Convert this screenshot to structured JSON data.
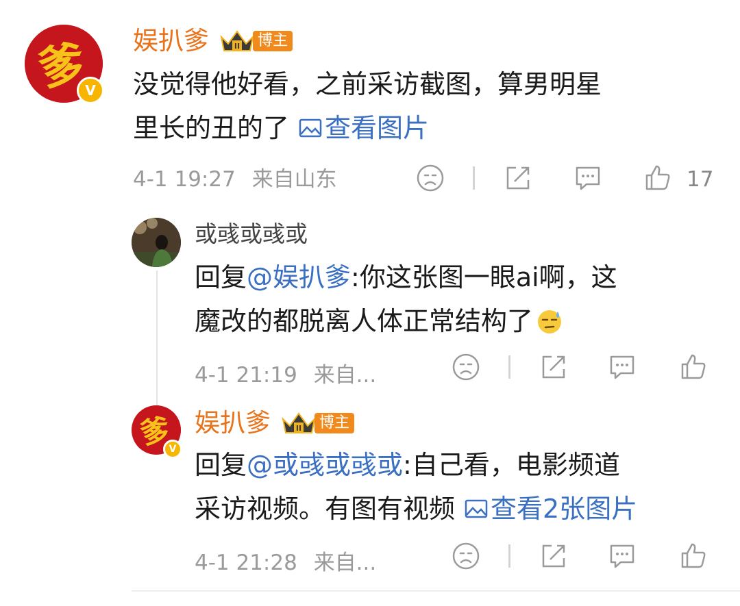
{
  "comment": {
    "username": "娱扒爹",
    "badge_label": "博主",
    "crown_level": "II",
    "avatar_text": "爹",
    "verified_mark": "V",
    "text_line1": "没觉得他好看，之前采访截图，算男明星",
    "text_line2": "里长的丑的了",
    "image_link": "查看图片",
    "timestamp": "4-1 19:27",
    "location": "来自山东",
    "like_count": "17"
  },
  "reply1": {
    "username": "或彧或彧或",
    "prefix": "回复",
    "mention": "@娱扒爹",
    "text_line1": ":你这张图一眼ai啊，这",
    "text_line2": "魔改的都脱离人体正常结构了",
    "emoji": "sweat-face",
    "timestamp": "4-1 21:19",
    "location": "来自..."
  },
  "reply2": {
    "username": "娱扒爹",
    "badge_label": "博主",
    "crown_level": "II",
    "avatar_text": "爹",
    "verified_mark": "V",
    "prefix": "回复",
    "mention": "@或彧或彧或",
    "text_line1": ":自己看，电影频道",
    "text_line2": "采访视频。有图有视频",
    "image_link": "查看2张图片",
    "timestamp": "4-1 21:28",
    "location": "来自..."
  },
  "colors": {
    "name_orange": "#e8731a",
    "link_blue": "#3a6fc2",
    "meta_gray": "#9a9a9a",
    "avatar_red": "#c4161c",
    "badge_orange": "#f08a1c",
    "verified_gold": "#f7b500"
  },
  "icons": [
    "dislike-face-icon",
    "share-icon",
    "comment-icon",
    "like-thumb-icon",
    "image-icon",
    "crown-icon",
    "verified-icon"
  ]
}
